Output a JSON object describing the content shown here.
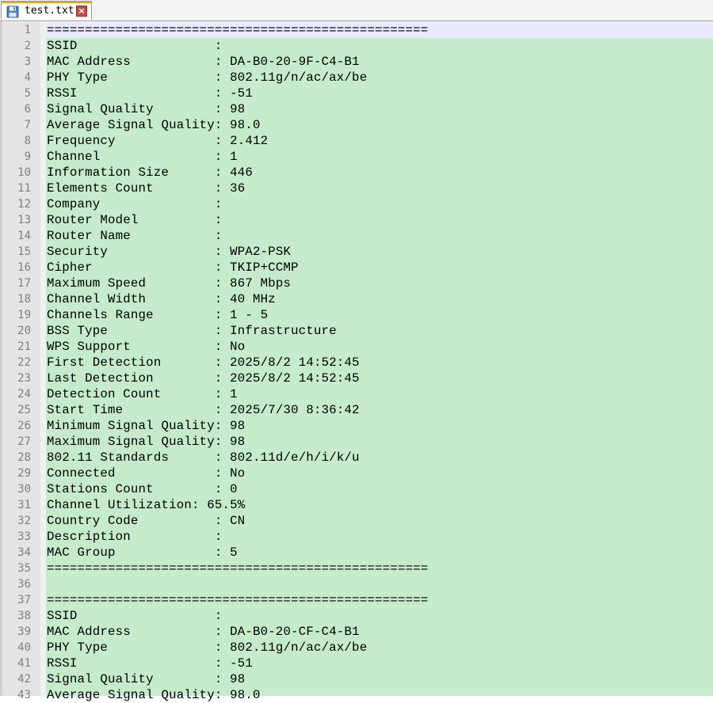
{
  "tab": {
    "filename": "test.txt",
    "close_glyph": "×",
    "icon": "floppy-disk-icon"
  },
  "editor": {
    "current_line": 1,
    "colors": {
      "text_background": "#c5ebcb",
      "current_line": "#e8e8ff",
      "gutter": "#e4e4e4",
      "line_number": "#808080"
    },
    "lines": [
      {
        "n": "1",
        "text": "=================================================="
      },
      {
        "n": "2",
        "text": "SSID                  :"
      },
      {
        "n": "3",
        "text": "MAC Address           : DA-B0-20-9F-C4-B1"
      },
      {
        "n": "4",
        "text": "PHY Type              : 802.11g/n/ac/ax/be"
      },
      {
        "n": "5",
        "text": "RSSI                  : -51"
      },
      {
        "n": "6",
        "text": "Signal Quality        : 98"
      },
      {
        "n": "7",
        "text": "Average Signal Quality: 98.0"
      },
      {
        "n": "8",
        "text": "Frequency             : 2.412"
      },
      {
        "n": "9",
        "text": "Channel               : 1"
      },
      {
        "n": "10",
        "text": "Information Size      : 446"
      },
      {
        "n": "11",
        "text": "Elements Count        : 36"
      },
      {
        "n": "12",
        "text": "Company               :"
      },
      {
        "n": "13",
        "text": "Router Model          :"
      },
      {
        "n": "14",
        "text": "Router Name           :"
      },
      {
        "n": "15",
        "text": "Security              : WPA2-PSK"
      },
      {
        "n": "16",
        "text": "Cipher                : TKIP+CCMP"
      },
      {
        "n": "17",
        "text": "Maximum Speed         : 867 Mbps"
      },
      {
        "n": "18",
        "text": "Channel Width         : 40 MHz"
      },
      {
        "n": "19",
        "text": "Channels Range        : 1 - 5"
      },
      {
        "n": "20",
        "text": "BSS Type              : Infrastructure"
      },
      {
        "n": "21",
        "text": "WPS Support           : No"
      },
      {
        "n": "22",
        "text": "First Detection       : 2025/8/2 14:52:45"
      },
      {
        "n": "23",
        "text": "Last Detection        : 2025/8/2 14:52:45"
      },
      {
        "n": "24",
        "text": "Detection Count       : 1"
      },
      {
        "n": "25",
        "text": "Start Time            : 2025/7/30 8:36:42"
      },
      {
        "n": "26",
        "text": "Minimum Signal Quality: 98"
      },
      {
        "n": "27",
        "text": "Maximum Signal Quality: 98"
      },
      {
        "n": "28",
        "text": "802.11 Standards      : 802.11d/e/h/i/k/u"
      },
      {
        "n": "29",
        "text": "Connected             : No"
      },
      {
        "n": "30",
        "text": "Stations Count        : 0"
      },
      {
        "n": "31",
        "text": "Channel Utilization: 65.5%"
      },
      {
        "n": "32",
        "text": "Country Code          : CN"
      },
      {
        "n": "33",
        "text": "Description           :"
      },
      {
        "n": "34",
        "text": "MAC Group             : 5"
      },
      {
        "n": "35",
        "text": "=================================================="
      },
      {
        "n": "36",
        "text": ""
      },
      {
        "n": "37",
        "text": "=================================================="
      },
      {
        "n": "38",
        "text": "SSID                  :"
      },
      {
        "n": "39",
        "text": "MAC Address           : DA-B0-20-CF-C4-B1"
      },
      {
        "n": "40",
        "text": "PHY Type              : 802.11g/n/ac/ax/be"
      },
      {
        "n": "41",
        "text": "RSSI                  : -51"
      },
      {
        "n": "42",
        "text": "Signal Quality        : 98"
      },
      {
        "n": "43",
        "text": "Average Signal Quality: 98.0"
      }
    ]
  }
}
